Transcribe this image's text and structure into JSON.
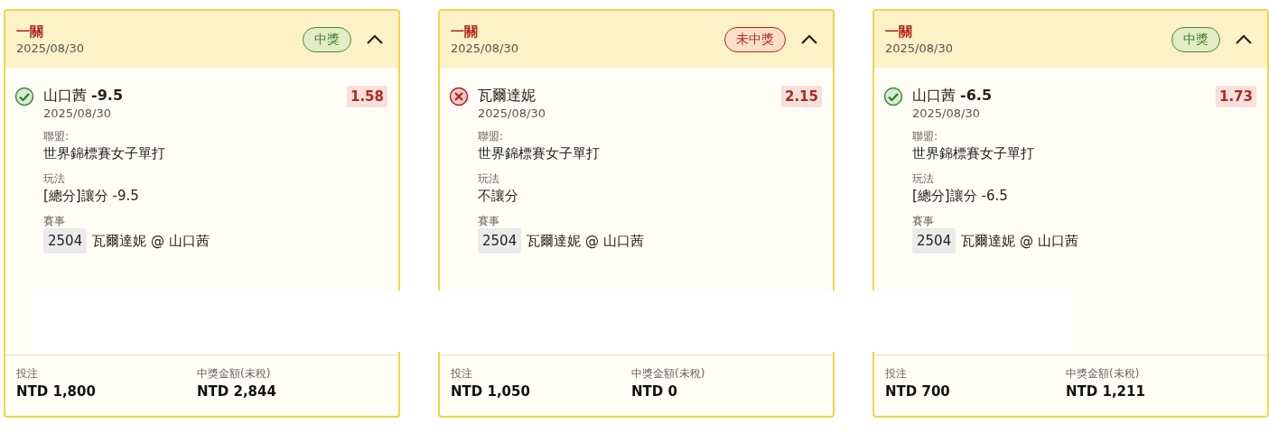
{
  "cards": [
    {
      "title": "一關",
      "date": "2025/08/30",
      "badge": {
        "label": "中獎",
        "kind": "won"
      },
      "expanded": true,
      "pick": {
        "kind": "won",
        "name": "山口茜 **-9.5**",
        "date": "2025/08/30",
        "odds": "1.58"
      },
      "fields": [
        {
          "label": "聯盟:",
          "value": "世界錦標賽女子單打"
        },
        {
          "label": "玩法",
          "value": "[總分]讓分 -9.5"
        },
        {
          "label": "賽事",
          "code": "2504",
          "value": "瓦爾達妮 @ 山口茜"
        }
      ],
      "stake": {
        "label": "投注",
        "value": "NTD 1,800"
      },
      "payout": {
        "label": "中獎金額(未稅)",
        "value": "NTD 2,844"
      }
    },
    {
      "title": "一關",
      "date": "2025/08/30",
      "badge": {
        "label": "未中獎",
        "kind": "lost"
      },
      "expanded": true,
      "pick": {
        "kind": "lost",
        "name": "瓦爾達妮",
        "date": "2025/08/30",
        "odds": "2.15"
      },
      "fields": [
        {
          "label": "聯盟:",
          "value": "世界錦標賽女子單打"
        },
        {
          "label": "玩法",
          "value": "不讓分"
        },
        {
          "label": "賽事",
          "code": "2504",
          "value": "瓦爾達妮 @ 山口茜"
        }
      ],
      "stake": {
        "label": "投注",
        "value": "NTD 1,050"
      },
      "payout": {
        "label": "中獎金額(未稅)",
        "value": "NTD 0"
      }
    },
    {
      "title": "一關",
      "date": "2025/08/30",
      "badge": {
        "label": "中獎",
        "kind": "won"
      },
      "expanded": true,
      "pick": {
        "kind": "won",
        "name": "山口茜 **-6.5**",
        "date": "2025/08/30",
        "odds": "1.73"
      },
      "fields": [
        {
          "label": "聯盟:",
          "value": "世界錦標賽女子單打"
        },
        {
          "label": "玩法",
          "value": "[總分]讓分 -6.5"
        },
        {
          "label": "賽事",
          "code": "2504",
          "value": "瓦爾達妮 @ 山口茜"
        }
      ],
      "stake": {
        "label": "投注",
        "value": "NTD 700"
      },
      "payout": {
        "label": "中獎金額(未稅)",
        "value": "NTD 1,211"
      }
    }
  ]
}
